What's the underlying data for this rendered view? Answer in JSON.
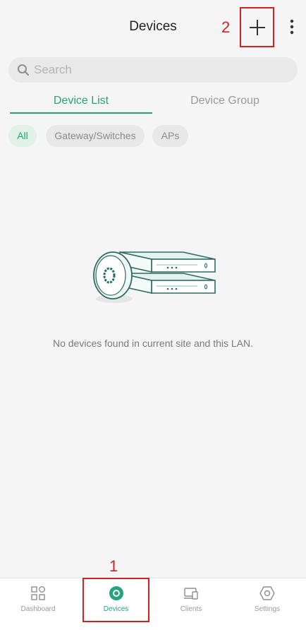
{
  "header": {
    "title": "Devices",
    "add_icon": "plus-icon",
    "more_icon": "vertical-dots-icon"
  },
  "annotations": {
    "step_one": "1",
    "step_two": "2"
  },
  "search": {
    "placeholder": "Search",
    "icon": "search-icon"
  },
  "tabs": [
    {
      "label": "Device List",
      "active": true
    },
    {
      "label": "Device Group",
      "active": false
    }
  ],
  "filters": [
    {
      "label": "All",
      "active": true
    },
    {
      "label": "Gateway/Switches",
      "active": false
    },
    {
      "label": "APs",
      "active": false
    }
  ],
  "empty_state": {
    "illustration": "devices-illustration",
    "message": "No devices found in current site and this LAN."
  },
  "bottom_nav": [
    {
      "label": "Dashboard",
      "icon": "dashboard-icon",
      "active": false
    },
    {
      "label": "Devices",
      "icon": "devices-icon",
      "active": true
    },
    {
      "label": "Clients",
      "icon": "clients-icon",
      "active": false
    },
    {
      "label": "Settings",
      "icon": "settings-icon",
      "active": false
    }
  ],
  "colors": {
    "accent": "#26a37a",
    "annotation": "#d41f26",
    "background": "#f5f5f5"
  }
}
